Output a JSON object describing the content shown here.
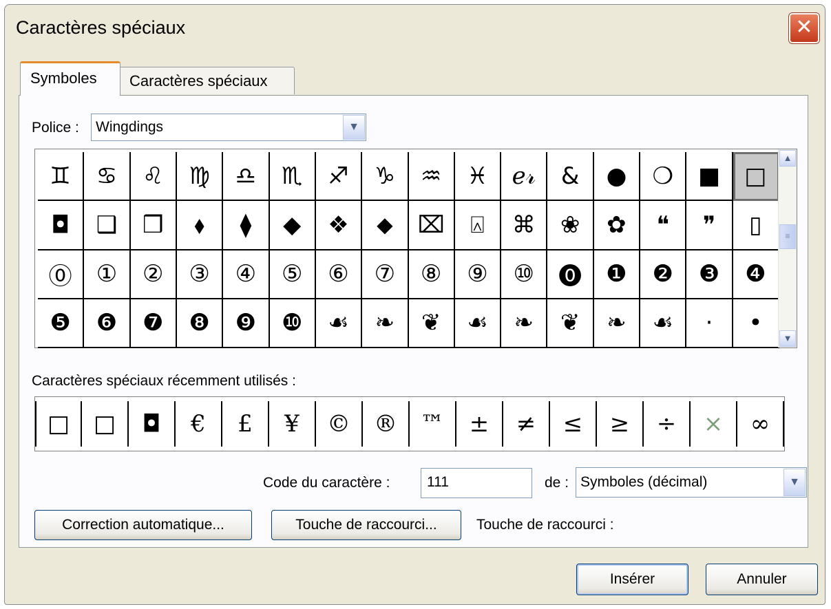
{
  "window": {
    "title": "Caractères spéciaux",
    "close_glyph": "✕"
  },
  "tabs": [
    {
      "label": "Symboles",
      "active": true
    },
    {
      "label": "Caractères spéciaux",
      "active": false
    }
  ],
  "font": {
    "label": "Police :",
    "value": "Wingdings"
  },
  "symbols": [
    [
      "♊",
      "♋",
      "♌",
      "♍",
      "♎",
      "♏",
      "♐",
      "♑",
      "♒",
      "♓",
      "ℯ𝓇",
      "&",
      "●",
      "❍",
      "■",
      "□"
    ],
    [
      "◘",
      "❑",
      "❒",
      "⬧",
      "⧫",
      "◆",
      "❖",
      "⬥",
      "⌧",
      "⍓",
      "⌘",
      "❀",
      "✿",
      "❝",
      "❞",
      "▯"
    ],
    [
      "⓪",
      "①",
      "②",
      "③",
      "④",
      "⑤",
      "⑥",
      "⑦",
      "⑧",
      "⑨",
      "⑩",
      "⓿",
      "❶",
      "❷",
      "❸",
      "❹"
    ],
    [
      "❺",
      "❻",
      "❼",
      "❽",
      "❾",
      "❿",
      "☙",
      "❧",
      "❦",
      "☙",
      "❧",
      "❦",
      "❧",
      "☙",
      "·",
      "•"
    ]
  ],
  "selected_symbol": {
    "row": 0,
    "col": 15
  },
  "recent": {
    "label": "Caractères spéciaux récemment utilisés :",
    "chars": [
      "□",
      "□",
      "◘",
      "€",
      "£",
      "¥",
      "©",
      "®",
      "™",
      "±",
      "≠",
      "≤",
      "≥",
      "÷",
      "×",
      "∞"
    ]
  },
  "char_code": {
    "label": "Code du caractère :",
    "value": "111"
  },
  "from": {
    "label": "de :",
    "value": "Symboles (décimal)"
  },
  "buttons": {
    "autocorrect": "Correction automatique...",
    "shortcut_key": "Touche de raccourci...",
    "shortcut_label": "Touche de raccourci :",
    "insert": "Insérer",
    "cancel": "Annuler"
  },
  "icons": {
    "scroll_up": "▲",
    "scroll_down": "▼",
    "thumb": "≡",
    "dropdown": "▼"
  }
}
